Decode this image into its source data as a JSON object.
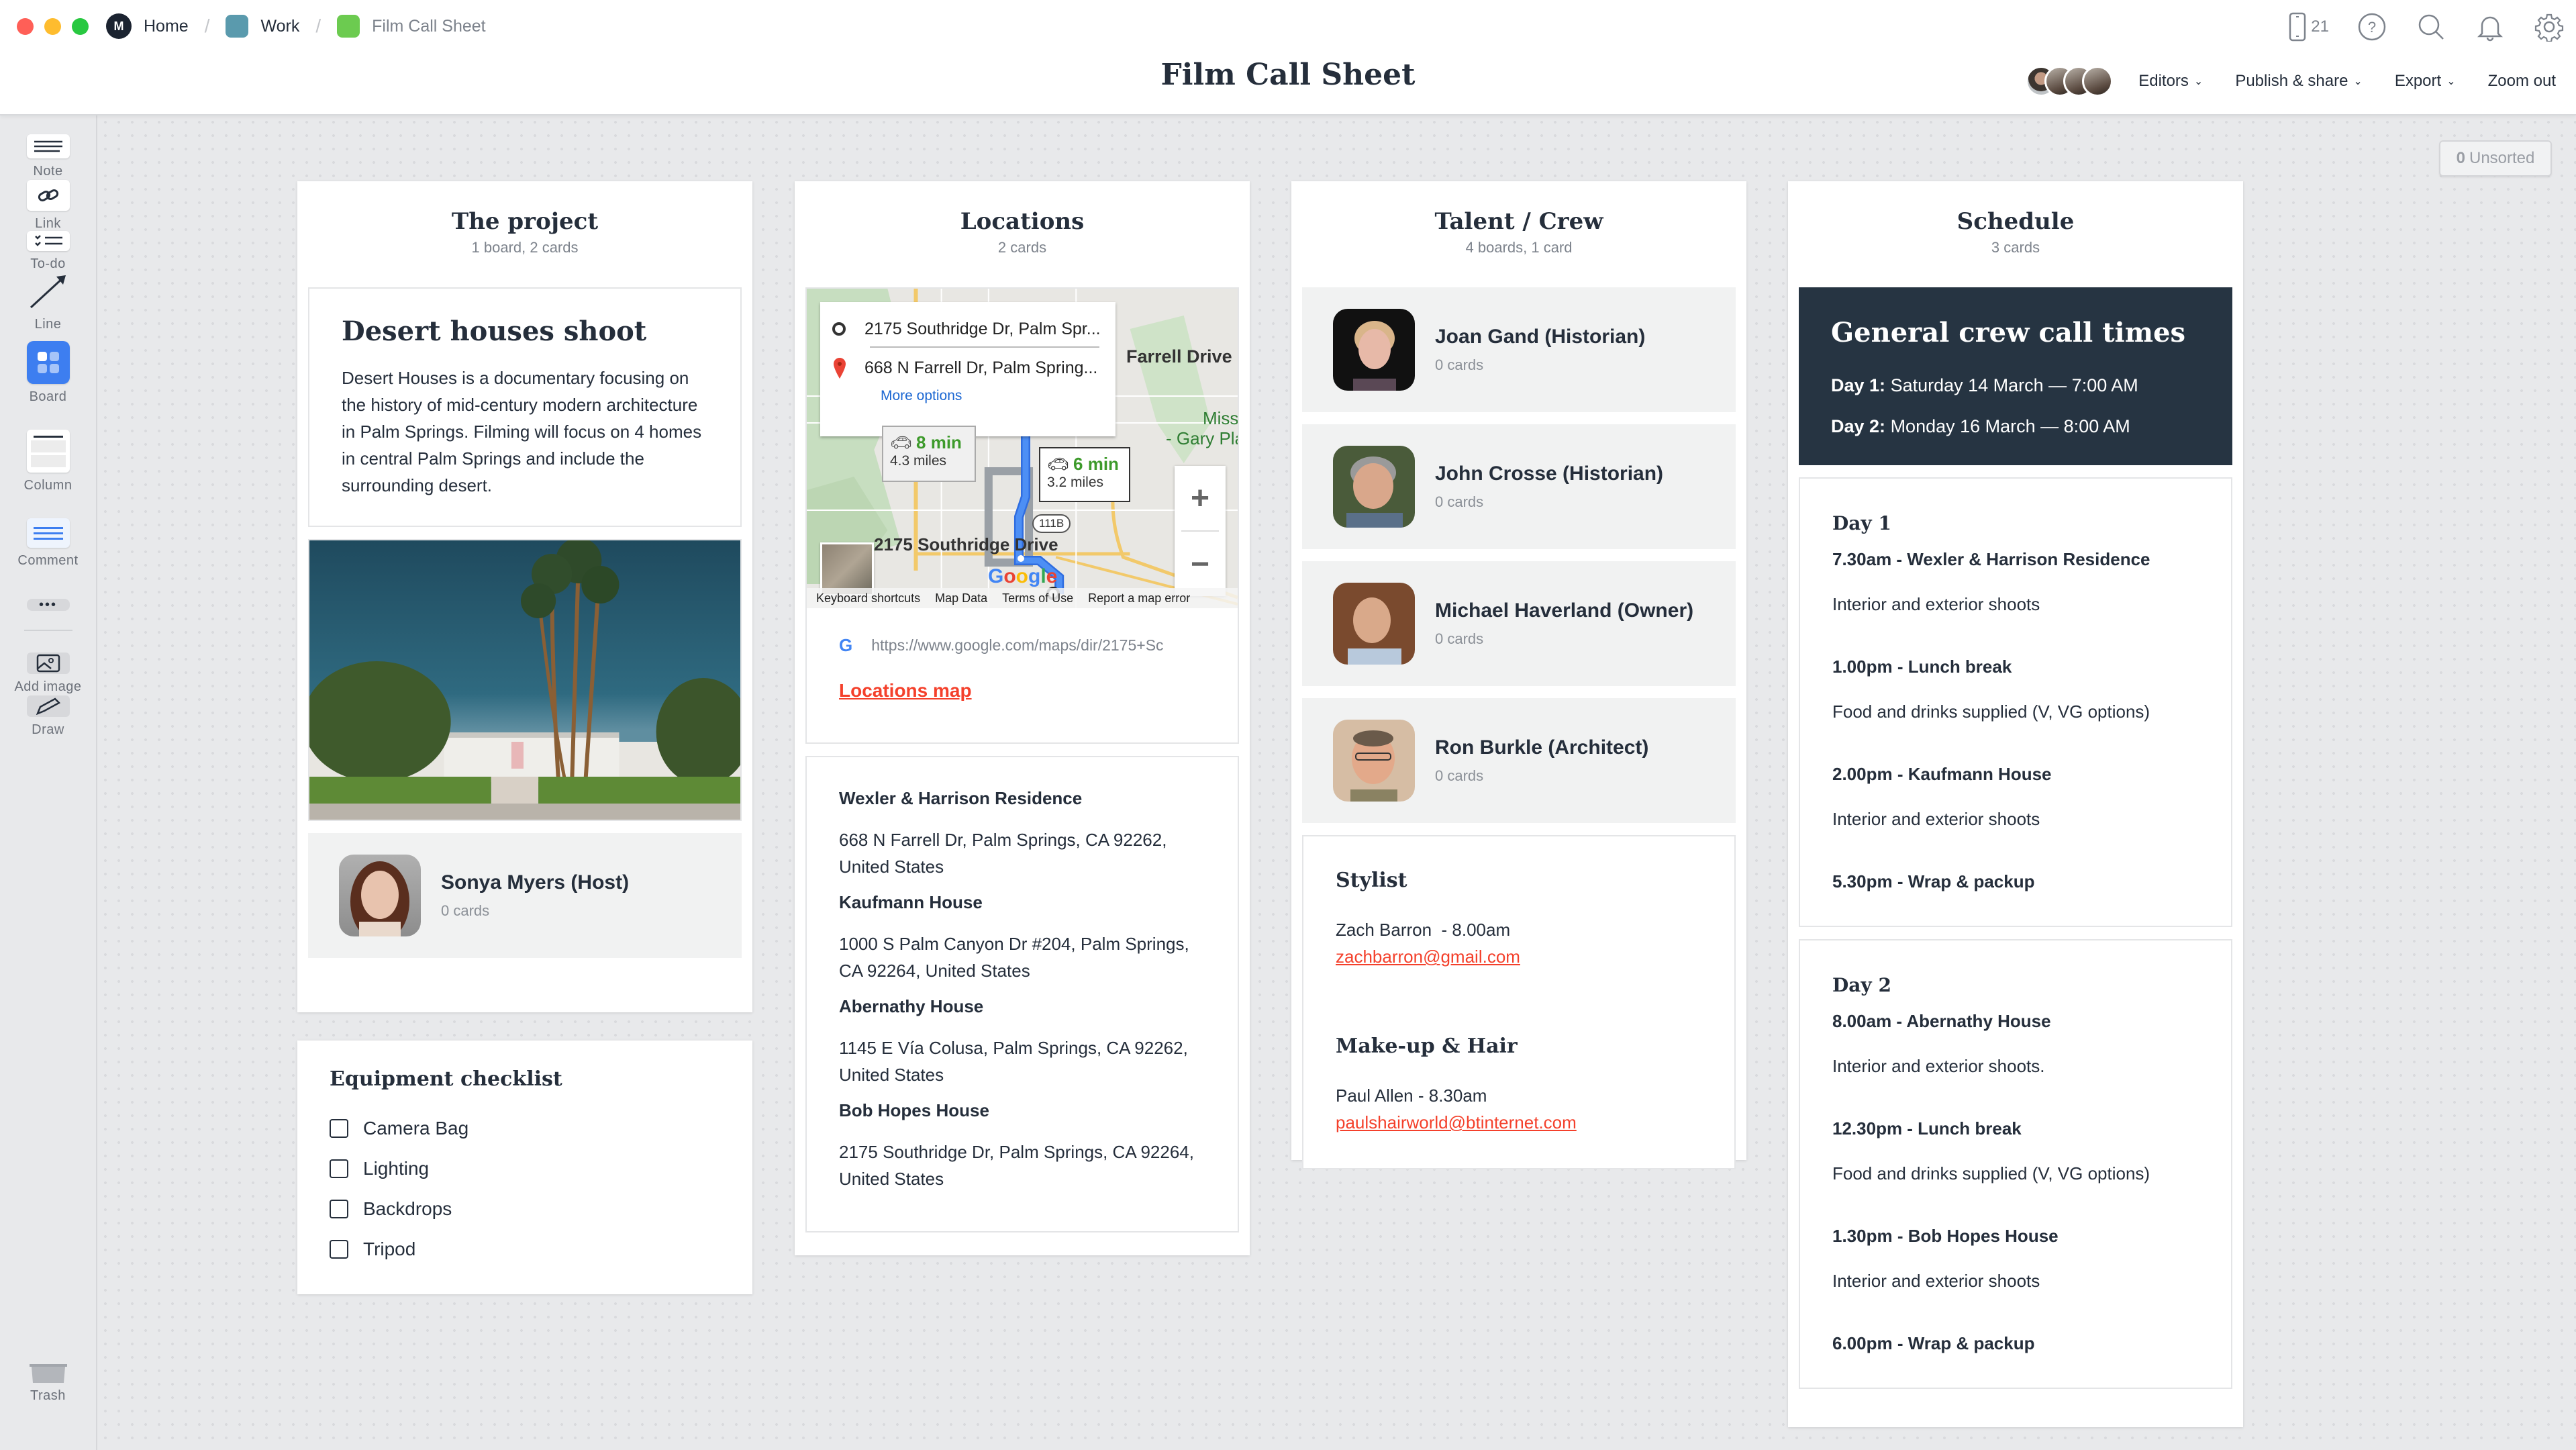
{
  "window": {
    "traffic_lights": {
      "close": "#ff5f57",
      "minimize": "#febc2e",
      "maximize": "#28c840"
    }
  },
  "breadcrumb": {
    "items": [
      {
        "label": "Home",
        "icon": "milanote-logo-icon",
        "color": "#1b2330"
      },
      {
        "label": "Work",
        "icon": "board-icon",
        "color": "#5a9aad"
      },
      {
        "label": "Film Call Sheet",
        "icon": "board-icon",
        "color": "#6ccb50"
      }
    ]
  },
  "header": {
    "title": "Film Call Sheet",
    "device_count": "21",
    "icons": [
      "mobile-icon",
      "help-icon",
      "search-icon",
      "bell-icon",
      "gear-icon"
    ],
    "actions": {
      "editors": "Editors",
      "publish": "Publish & share",
      "export": "Export",
      "zoom_out": "Zoom out"
    },
    "editor_avatar_count": 4
  },
  "sidebar": {
    "tools": [
      {
        "label": "Note",
        "icon": "note-icon"
      },
      {
        "label": "Link",
        "icon": "link-icon"
      },
      {
        "label": "To-do",
        "icon": "todo-icon"
      },
      {
        "label": "Line",
        "icon": "line-arrow-icon"
      },
      {
        "label": "Board",
        "icon": "board-icon"
      },
      {
        "label": "Column",
        "icon": "column-icon"
      },
      {
        "label": "Comment",
        "icon": "comment-icon"
      },
      {
        "label": "",
        "icon": "more-icon"
      },
      {
        "label": "Add image",
        "icon": "image-icon"
      },
      {
        "label": "Draw",
        "icon": "pencil-icon"
      }
    ],
    "trash_label": "Trash",
    "accent": "#3d7ef0"
  },
  "unsorted": {
    "count": "0",
    "label": "Unsorted"
  },
  "columns": {
    "project": {
      "title": "The project",
      "subtitle": "1 board, 2 cards",
      "note": {
        "title": "Desert houses shoot",
        "body": "Desert Houses is a documentary focusing on the history of mid-century modern architecture in Palm Springs. Filming will focus on 4 homes in central Palm Springs and include the surrounding desert."
      },
      "image_alt": "Mid-century modern house with tall palm trees",
      "host": {
        "name": "Sonya Myers (Host)",
        "count": "0 cards"
      },
      "checklist": {
        "title": "Equipment checklist",
        "items": [
          {
            "label": "Camera Bag",
            "checked": false
          },
          {
            "label": "Lighting",
            "checked": false
          },
          {
            "label": "Backdrops",
            "checked": false
          },
          {
            "label": "Tripod",
            "checked": false
          }
        ]
      }
    },
    "locations": {
      "title": "Locations",
      "subtitle": "2 cards",
      "map": {
        "origin": "2175 Southridge Dr, Palm Spr...",
        "destination": "668 N Farrell Dr, Palm Spring...",
        "more_options": "More options",
        "route1": {
          "time": "8 min",
          "distance": "4.3 miles"
        },
        "route2": {
          "time": "6 min",
          "distance": "3.2 miles"
        },
        "label_farrell": "Farrell Drive",
        "label_southridge": "2175 Southridge Drive",
        "label_miss": "Miss",
        "label_gary": "- Gary Pla",
        "highway": "111B",
        "google": "Google",
        "footer": [
          "Keyboard shortcuts",
          "Map Data",
          "Terms of Use",
          "Report a map error"
        ],
        "zoom_in": "+",
        "zoom_out": "−"
      },
      "link": {
        "url": "https://www.google.com/maps/dir/2175+Sc",
        "title": "Locations map"
      },
      "places": [
        {
          "name": "Wexler & Harrison Residence",
          "address": "668 N Farrell Dr, Palm Springs, CA 92262, United States"
        },
        {
          "name": "Kaufmann House",
          "address": "1000 S Palm Canyon Dr #204, Palm Springs, CA 92264, United States"
        },
        {
          "name": "Abernathy House",
          "address": "1145 E Vía Colusa, Palm Springs, CA 92262, United States"
        },
        {
          "name": "Bob Hopes House",
          "address": "2175 Southridge Dr, Palm Springs, CA 92264, United States"
        }
      ]
    },
    "talent": {
      "title": "Talent / Crew",
      "subtitle": "4 boards, 1 card",
      "people": [
        {
          "name": "Joan Gand (Historian)",
          "count": "0 cards"
        },
        {
          "name": "John Crosse (Historian)",
          "count": "0 cards"
        },
        {
          "name": "Michael Haverland (Owner)",
          "count": "0 cards"
        },
        {
          "name": "Ron Burkle (Architect)",
          "count": "0 cards"
        }
      ],
      "crew": [
        {
          "role": "Stylist",
          "line": "Zach Barron  - 8.00am",
          "email": "zachbarron@gmail.com"
        },
        {
          "role": "Make-up & Hair",
          "line": "Paul Allen - 8.30am",
          "email": "paulshairworld@btinternet.com"
        }
      ]
    },
    "schedule": {
      "title": "Schedule",
      "subtitle": "3 cards",
      "call_times": {
        "title": "General crew call times",
        "lines": [
          {
            "label": "Day 1:",
            "value": "Saturday 14 March — 7:00 AM"
          },
          {
            "label": "Day 2:",
            "value": "Monday 16 March — 8:00 AM"
          }
        ]
      },
      "days": [
        {
          "title": "Day 1",
          "entries": [
            {
              "time": "7.30am - Wexler & Harrison Residence",
              "desc": "Interior and exterior shoots"
            },
            {
              "time": "1.00pm - Lunch break",
              "desc": "Food and drinks supplied (V, VG options)"
            },
            {
              "time": "2.00pm - Kaufmann House",
              "desc": "Interior and exterior shoots"
            },
            {
              "time": "5.30pm - Wrap & packup",
              "desc": ""
            }
          ]
        },
        {
          "title": "Day 2",
          "entries": [
            {
              "time": "8.00am - Abernathy House",
              "desc": "Interior and exterior shoots."
            },
            {
              "time": "12.30pm - Lunch break",
              "desc": "Food and drinks supplied (V, VG options)"
            },
            {
              "time": "1.30pm - Bob Hopes House",
              "desc": "Interior and exterior shoots"
            },
            {
              "time": "6.00pm - Wrap & packup",
              "desc": ""
            }
          ]
        }
      ]
    }
  },
  "colors": {
    "link_red": "#f4402b",
    "dark_card": "#263442",
    "text": "#252e3b",
    "muted": "#7d838c",
    "route_blue": "#4285f4",
    "route_time_green": "#3d9a2b"
  }
}
